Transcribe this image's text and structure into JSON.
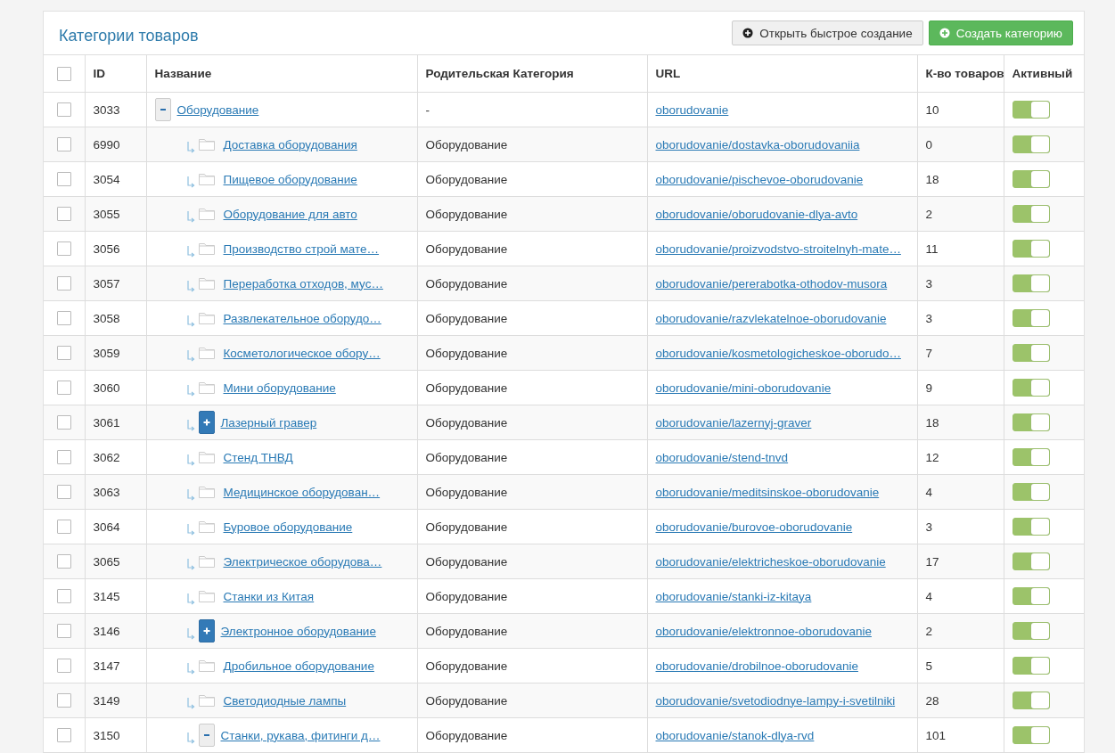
{
  "panel": {
    "title": "Категории товаров"
  },
  "buttons": [
    {
      "kind": "default",
      "label": "Открыть быстрое создание"
    },
    {
      "kind": "success",
      "label": "Создать категорию"
    }
  ],
  "table": {
    "select_all": {
      "checked": false
    },
    "columns": [
      "ID",
      "Название",
      "Родительская Категория",
      "URL",
      "К-во товаров",
      "Активный"
    ],
    "rows": [
      {
        "kind": "group",
        "expanded": true,
        "checked": false,
        "id": "3033",
        "name": "Оборудование",
        "parent": "-",
        "url": "oborudovanie",
        "count": "10",
        "active": true,
        "children": [
          {
            "kind": "folder",
            "checked": false,
            "id": "6990",
            "name": "Доставка оборудования",
            "parent": "Оборудование",
            "url": "oborudovanie/dostavka-oborudovaniia",
            "count": "0",
            "active": true
          },
          {
            "kind": "folder",
            "checked": false,
            "id": "3054",
            "name": "Пищевое оборудование",
            "parent": "Оборудование",
            "url": "oborudovanie/pischevoe-oborudovanie",
            "count": "18",
            "active": true
          },
          {
            "kind": "folder",
            "checked": false,
            "id": "3055",
            "name": "Оборудование для авто",
            "parent": "Оборудование",
            "url": "oborudovanie/oborudovanie-dlya-avto",
            "count": "2",
            "active": true
          },
          {
            "kind": "folder",
            "checked": false,
            "id": "3056",
            "name": "Производство строй мате…",
            "parent": "Оборудование",
            "url": "oborudovanie/proizvodstvo-stroitelnyh-mate…",
            "count": "11",
            "active": true
          },
          {
            "kind": "folder",
            "checked": false,
            "id": "3057",
            "name": "Переработка отходов, мус…",
            "parent": "Оборудование",
            "url": "oborudovanie/pererabotka-othodov-musora",
            "count": "3",
            "active": true
          },
          {
            "kind": "folder",
            "checked": false,
            "id": "3058",
            "name": "Развлекательное оборудо…",
            "parent": "Оборудование",
            "url": "oborudovanie/razvlekatelnoe-oborudovanie",
            "count": "3",
            "active": true
          },
          {
            "kind": "folder",
            "checked": false,
            "id": "3059",
            "name": "Косметологическое обору…",
            "parent": "Оборудование",
            "url": "oborudovanie/kosmetologicheskoe-oborudo…",
            "count": "7",
            "active": true
          },
          {
            "kind": "folder",
            "checked": false,
            "id": "3060",
            "name": "Мини оборудование",
            "parent": "Оборудование",
            "url": "oborudovanie/mini-oborudovanie",
            "count": "9",
            "active": true
          },
          {
            "kind": "group",
            "expanded": false,
            "checked": false,
            "id": "3061",
            "name": "Лазерный гравер",
            "parent": "Оборудование",
            "url": "oborudovanie/lazernyj-graver",
            "count": "18",
            "active": true
          },
          {
            "kind": "folder",
            "checked": false,
            "id": "3062",
            "name": "Стенд ТНВД",
            "parent": "Оборудование",
            "url": "oborudovanie/stend-tnvd",
            "count": "12",
            "active": true
          },
          {
            "kind": "folder",
            "checked": false,
            "id": "3063",
            "name": "Медицинское оборудован…",
            "parent": "Оборудование",
            "url": "oborudovanie/meditsinskoe-oborudovanie",
            "count": "4",
            "active": true
          },
          {
            "kind": "folder",
            "checked": false,
            "id": "3064",
            "name": "Буровое оборудование",
            "parent": "Оборудование",
            "url": "oborudovanie/burovoe-oborudovanie",
            "count": "3",
            "active": true
          },
          {
            "kind": "folder",
            "checked": false,
            "id": "3065",
            "name": "Электрическое оборудова…",
            "parent": "Оборудование",
            "url": "oborudovanie/elektricheskoe-oborudovanie",
            "count": "17",
            "active": true
          },
          {
            "kind": "folder",
            "checked": false,
            "id": "3145",
            "name": "Станки из Китая",
            "parent": "Оборудование",
            "url": "oborudovanie/stanki-iz-kitaya",
            "count": "4",
            "active": true
          },
          {
            "kind": "group",
            "expanded": false,
            "checked": false,
            "id": "3146",
            "name": "Электронное оборудование",
            "parent": "Оборудование",
            "url": "oborudovanie/elektronnoe-oborudovanie",
            "count": "2",
            "active": true
          },
          {
            "kind": "folder",
            "checked": false,
            "id": "3147",
            "name": "Дробильное оборудование",
            "parent": "Оборудование",
            "url": "oborudovanie/drobilnoe-oborudovanie",
            "count": "5",
            "active": true
          },
          {
            "kind": "folder",
            "checked": false,
            "id": "3149",
            "name": "Светодиодные лампы",
            "parent": "Оборудование",
            "url": "oborudovanie/svetodiodnye-lampy-i-svetilniki",
            "count": "28",
            "active": true
          },
          {
            "kind": "group",
            "expanded": true,
            "checked": false,
            "id": "3150",
            "name": "Станки, рукава, фитинги д…",
            "parent": "Оборудование",
            "url": "oborudovanie/stanok-dlya-rvd",
            "count": "101",
            "active": true
          }
        ]
      }
    ]
  }
}
